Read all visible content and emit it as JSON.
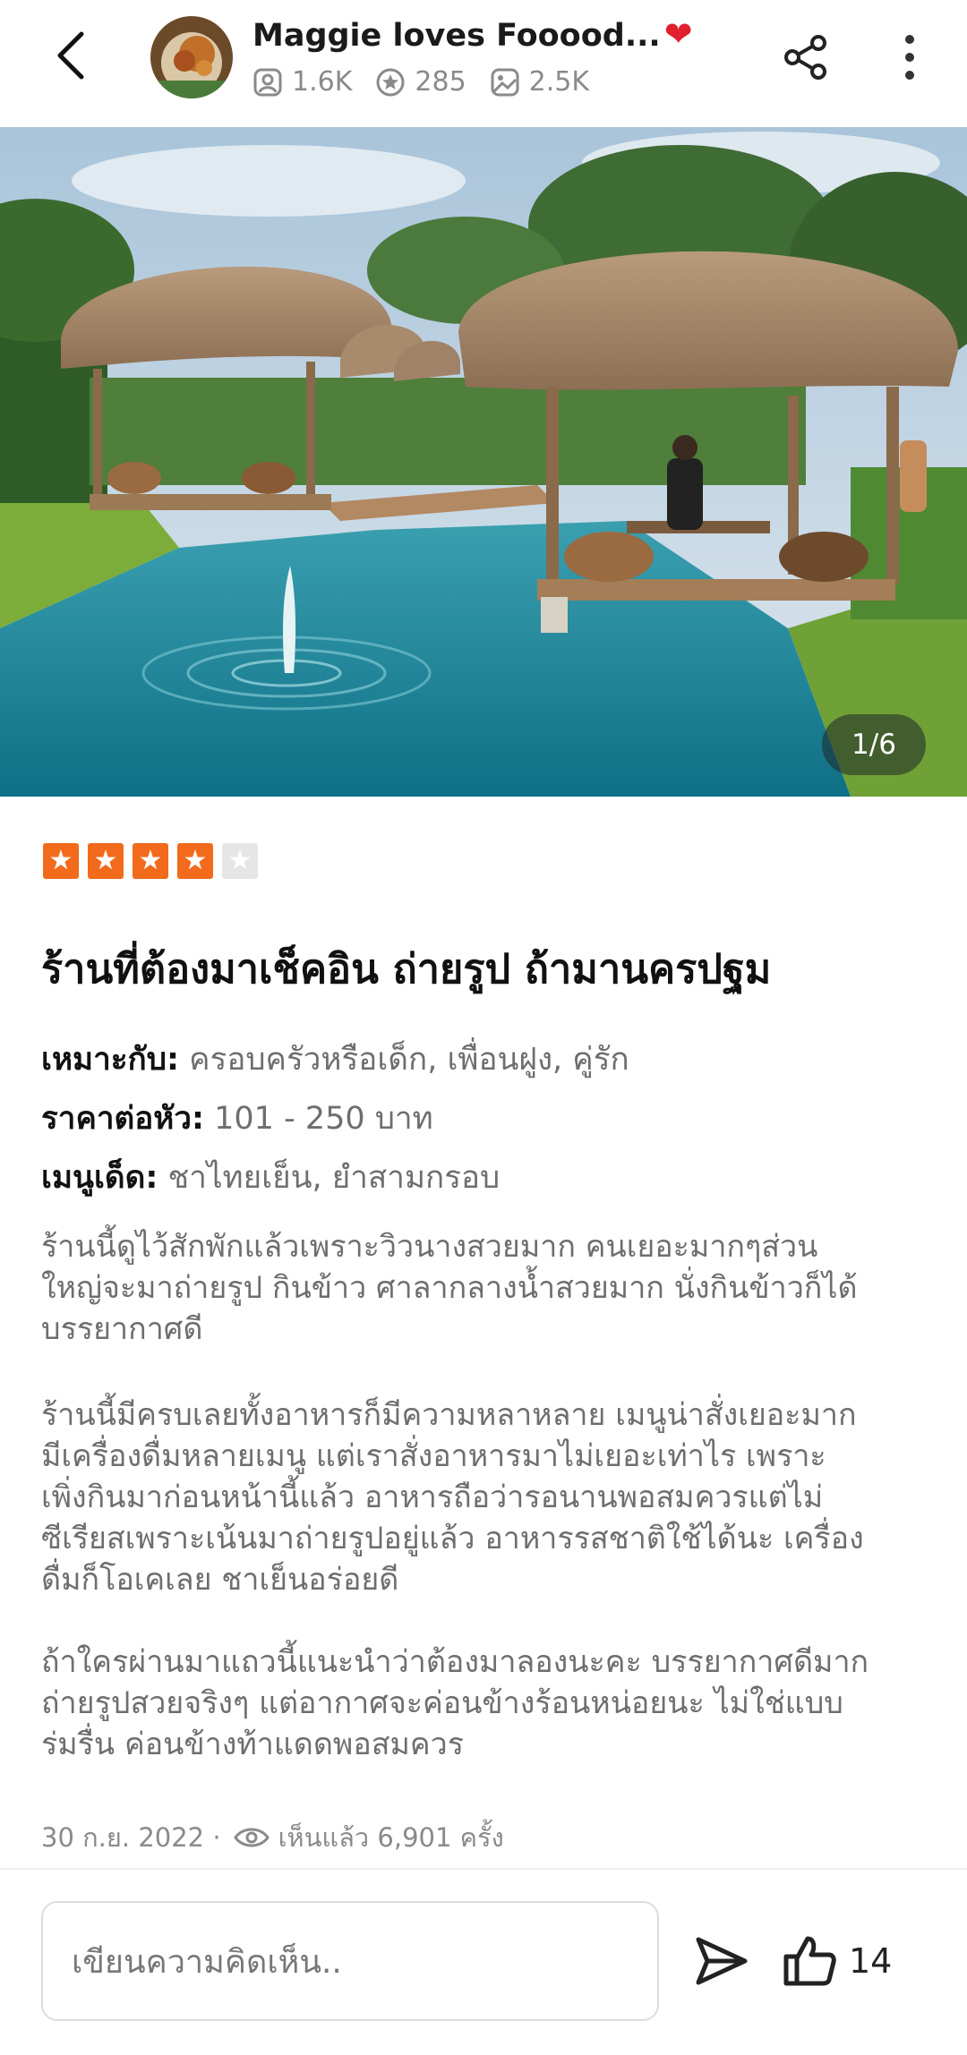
{
  "header": {
    "author_name": "Maggie loves Fooood...",
    "stats": {
      "followers": "1.6K",
      "reviews": "285",
      "photos": "2.5K"
    }
  },
  "hero": {
    "counter": "1/6"
  },
  "review": {
    "rating": 4,
    "rating_max": 5,
    "title": "ร้านที่ต้องมาเช็คอิน ถ่ายรูป ถ้ามานครปฐม",
    "suitable_label": "เหมาะกับ:",
    "suitable_value": "ครอบครัวหรือเด็ก, เพื่อนฝูง, คู่รัก",
    "price_label": "ราคาต่อหัว:",
    "price_value": "101 - 250 บาท",
    "menu_label": "เมนูเด็ด:",
    "menu_value": "ชาไทยเย็น, ยำสามกรอบ",
    "paragraphs": [
      [
        "ร้านนี้ดูไว้สักพักแล้วเพราะวิวนางสวยมาก คนเยอะมากๆส่วน",
        "ใหญ่จะมาถ่ายรูป กินข้าว ศาลากลางน้ำสวยมาก นั่งกินข้าวก็ได้",
        "บรรยากาศดี"
      ],
      [
        "ร้านนี้มีครบเลยทั้งอาหารก็มีความหลาหลาย เมนูน่าสั่งเยอะมาก",
        "มีเครื่องดื่มหลายเมนู แต่เราสั่งอาหารมาไม่เยอะเท่าไร เพราะ",
        "เพิ่งกินมาก่อนหน้านี้แล้ว อาหารถือว่ารอนานพอสมควรแต่ไม่",
        "ซีเรียสเพราะเน้นมาถ่ายรูปอยู่แล้ว อาหารรสชาติใช้ได้นะ เครื่อง",
        "ดื่มก็โอเคเลย ชาเย็นอร่อยดี"
      ],
      [
        "ถ้าใครผ่านมาแถวนี้แนะนำว่าต้องมาลองนะคะ บรรยากาศดีมาก",
        "ถ่ายรูปสวยจริงๆ แต่อากาศจะค่อนข้างร้อนหน่อยนะ ไม่ใช่แบบ",
        "ร่มรื่น ค่อนข้างท้าแดดพอสมควร"
      ]
    ],
    "date": "30 ก.ย. 2022 ·",
    "views": "เห็นแล้ว 6,901 ครั้ง"
  },
  "footer": {
    "comment_placeholder": "เขียนความคิดเห็น..",
    "like_count": "14"
  },
  "colors": {
    "star_on": "#f26a1b",
    "star_off": "#e6e6e6",
    "text_muted": "#6e6e6e"
  }
}
